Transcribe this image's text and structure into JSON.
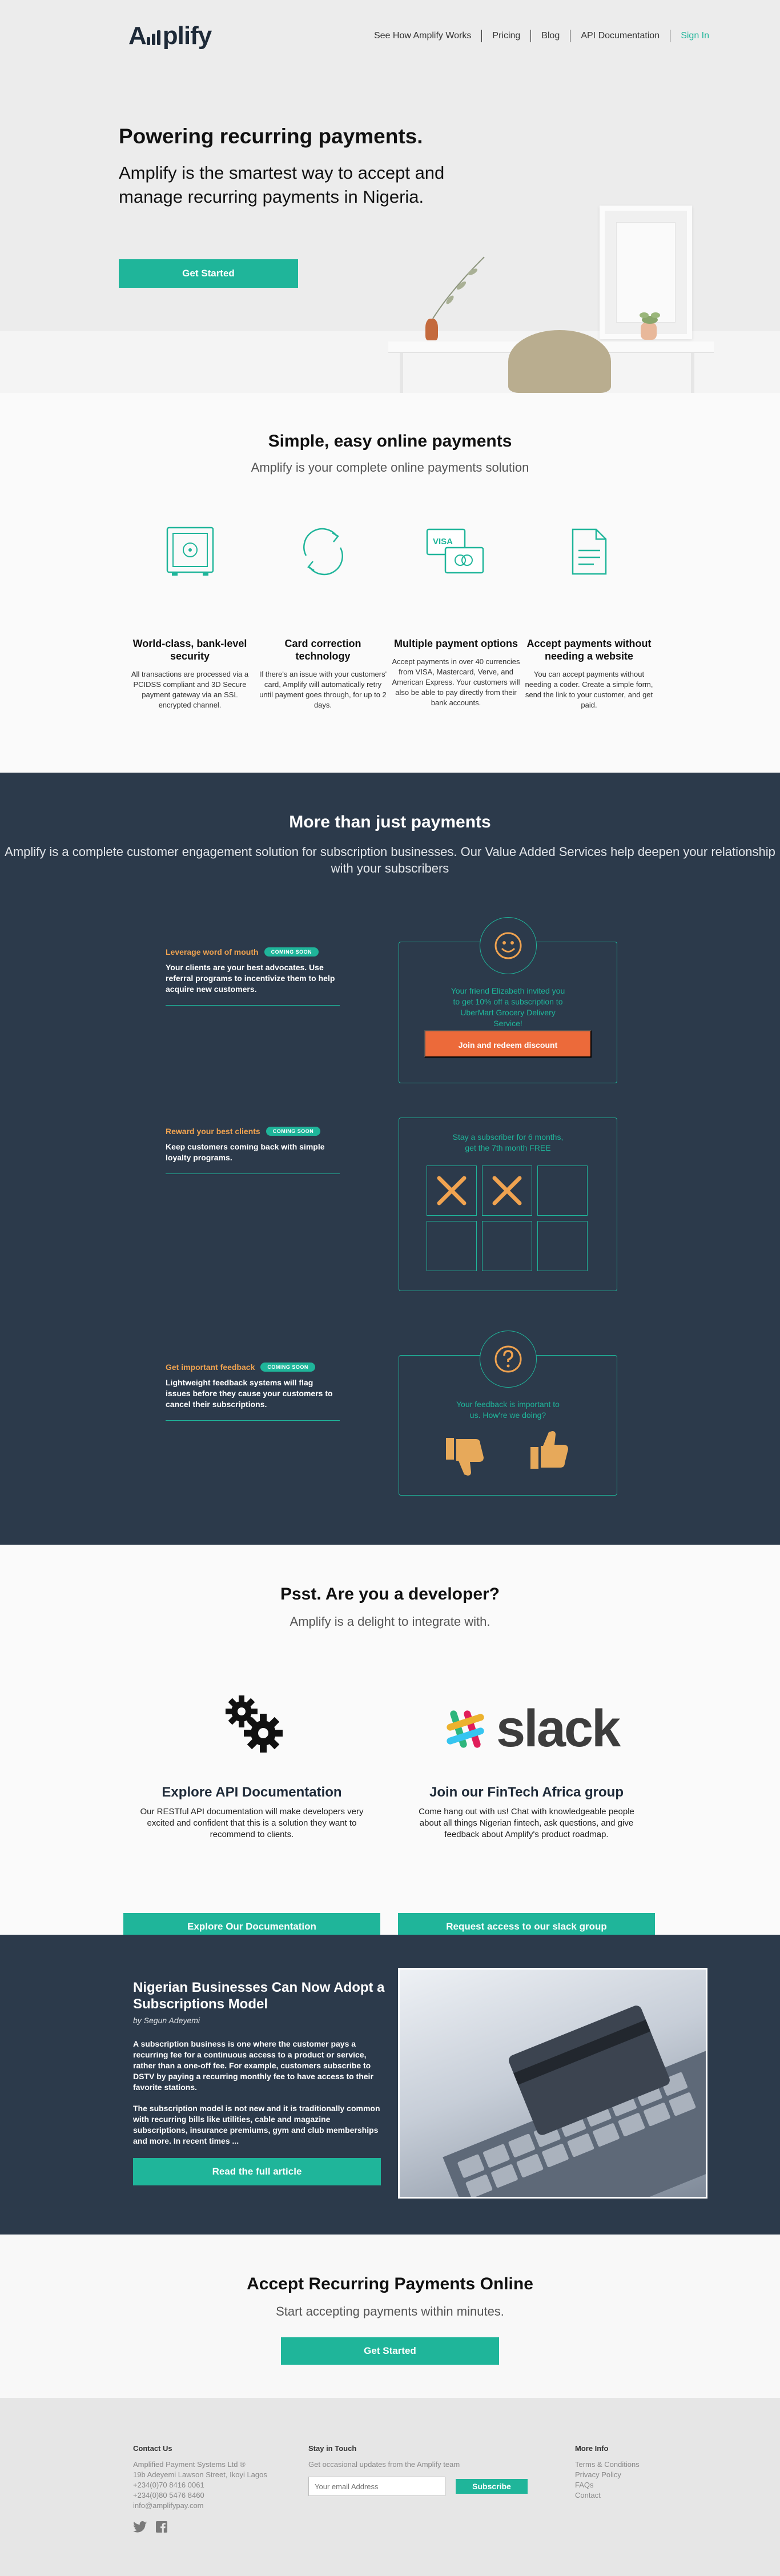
{
  "nav": {
    "logo": "Amplify",
    "links": [
      "See How Amplify Works",
      "Pricing",
      "Blog",
      "API Documentation"
    ],
    "signin": "Sign In"
  },
  "hero": {
    "title": "Powering recurring payments.",
    "subtitle": "Amplify is the smartest way to accept and manage recurring payments in Nigeria.",
    "cta": "Get Started"
  },
  "features": {
    "title": "Simple, easy online payments",
    "subtitle": "Amplify is your complete online payments solution",
    "items": [
      {
        "icon": "safe-icon",
        "title": "World-class, bank-level security",
        "desc": "All transactions are processed via a PCIDSS compliant and 3D Secure payment gateway via an SSL encrypted channel."
      },
      {
        "icon": "refresh-icon",
        "title": "Card correction technology",
        "desc": "If there's an issue with your customers' card, Amplify will automatically retry until payment goes through, for up to 2 days."
      },
      {
        "icon": "credit-cards-icon",
        "title": "Multiple payment options",
        "desc": "Accept payments in over 40 currencies from VISA, Mastercard, Verve, and American Express. Your customers will also be able to pay directly from their bank accounts."
      },
      {
        "icon": "document-icon",
        "title": "Accept payments without needing a website",
        "desc": "You can accept payments without needing a coder. Create a simple form, send the link to your customer, and get paid."
      }
    ]
  },
  "value_added": {
    "title": "More than just payments",
    "subtitle": "Amplify is a complete customer engagement solution for subscription businesses. Our Value Added Services help deepen your relationship with your subscribers",
    "badge": "COMING SOON",
    "items": [
      {
        "title": "Leverage word of mouth",
        "desc": "Your clients are your best advocates. Use referral programs to incentivize them to help acquire new customers.",
        "card_msg": "Your friend Elizabeth invited you to get 10% off a subscription to UberMart Grocery Delivery Service!",
        "card_btn": "Join and redeem discount"
      },
      {
        "title": "Reward your best clients",
        "desc": "Keep customers coming back with simple loyalty programs.",
        "card_msg": "Stay a subscriber for 6 months, get the 7th month FREE"
      },
      {
        "title": "Get important feedback",
        "desc": "Lightweight feedback systems will flag issues before they cause your customers to cancel their subscriptions.",
        "card_msg": "Your feedback is important to us. How're we doing?"
      }
    ]
  },
  "developer": {
    "title": "Psst. Are you a developer?",
    "subtitle": "Amplify is a delight to integrate with.",
    "cols": [
      {
        "title": "Explore API Documentation",
        "desc": "Our RESTful API documentation will make developers very excited and confident that this is a solution they want to recommend to clients.",
        "btn": "Explore Our Documentation"
      },
      {
        "title": "Join our FinTech Africa group",
        "desc": "Come hang out with us! Chat with knowledgeable people about all things Nigerian fintech, ask questions, and give feedback about Amplify's product roadmap.",
        "btn": "Request access to our slack group",
        "logo_text": "slack"
      }
    ]
  },
  "article": {
    "title": "Nigerian Businesses Can Now Adopt a Subscriptions Model",
    "author": "by Segun Adeyemi",
    "paragraphs": [
      "A subscription business is one where the customer pays a recurring fee for a continuous access to a product or service, rather than a one-off fee. For example, customers subscribe to DSTV by paying a recurring monthly fee to have access to their favorite stations.",
      "The subscription model is not new and it is traditionally common with recurring bills like utilities, cable and magazine subscriptions, insurance premiums, gym and club memberships and more. In recent times ..."
    ],
    "btn": "Read the full article"
  },
  "cta": {
    "title": "Accept Recurring Payments Online",
    "subtitle": "Start accepting payments within minutes.",
    "btn": "Get Started"
  },
  "footer": {
    "contact": {
      "title": "Contact Us",
      "lines": [
        "Amplified Payment Systems Ltd ®",
        "19b Adeyemi Lawson Street, Ikoyi Lagos",
        "+234(0)70 8416 0061",
        "+234(0)80 5476 8460",
        "info@amplifypay.com"
      ]
    },
    "touch": {
      "title": "Stay in Touch",
      "desc": "Get occasional updates from the Amplify team",
      "placeholder": "Your email Address",
      "btn": "Subscribe"
    },
    "more": {
      "title": "More Info",
      "links": [
        "Terms & Conditions",
        "Privacy Policy",
        "FAQs",
        "Contact"
      ]
    }
  },
  "colors": {
    "accent": "#1fb59a",
    "dark": "#2c3a4b",
    "orange": "#f0a350",
    "redeem": "#ec6a3a"
  }
}
